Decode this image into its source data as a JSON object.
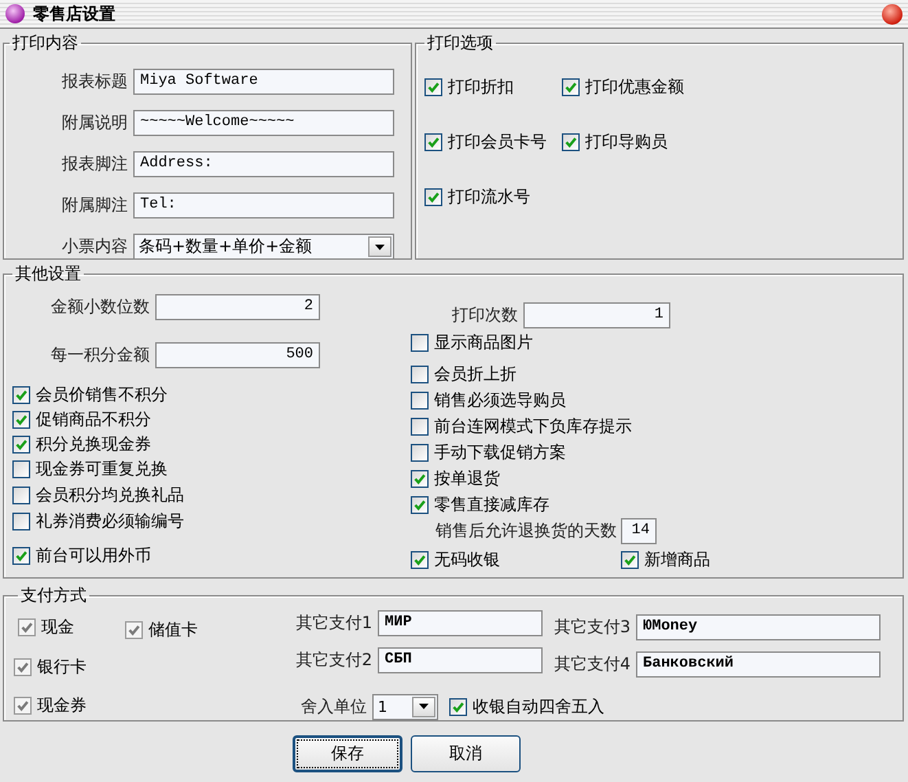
{
  "window": {
    "title": "零售店设置"
  },
  "print_content": {
    "title": "打印内容",
    "fields": [
      {
        "label": "报表标题",
        "value": "Miya Software"
      },
      {
        "label": "附属说明",
        "value": "~~~~~Welcome~~~~~"
      },
      {
        "label": "报表脚注",
        "value": "Address:"
      },
      {
        "label": "附属脚注",
        "value": "Tel:"
      }
    ],
    "receipt": {
      "label": "小票内容",
      "value": "条码+数量+单价+金额"
    }
  },
  "print_options": {
    "title": "打印选项",
    "items": [
      {
        "label": "打印折扣",
        "checked": true
      },
      {
        "label": "打印优惠金额",
        "checked": true
      },
      {
        "label": "打印会员卡号",
        "checked": true
      },
      {
        "label": "打印导购员",
        "checked": true
      },
      {
        "label": "打印流水号",
        "checked": true
      }
    ]
  },
  "other_settings": {
    "title": "其他设置",
    "left_fields": [
      {
        "label": "金额小数位数",
        "value": "2"
      },
      {
        "label": "每一积分金额",
        "value": "500"
      }
    ],
    "left_checks": [
      {
        "label": "会员价销售不积分",
        "checked": true
      },
      {
        "label": "促销商品不积分",
        "checked": true
      },
      {
        "label": "积分兑换现金券",
        "checked": true
      },
      {
        "label": "现金券可重复兑换",
        "checked": false
      },
      {
        "label": "会员积分均兑换礼品",
        "checked": false
      },
      {
        "label": "礼券消费必须输编号",
        "checked": false
      },
      {
        "label": "前台可以用外币",
        "checked": true
      }
    ],
    "print_count": {
      "label": "打印次数",
      "value": "1"
    },
    "right_checks": [
      {
        "label": "显示商品图片",
        "checked": false
      },
      {
        "label": "会员折上折",
        "checked": false
      },
      {
        "label": "销售必须选导购员",
        "checked": false
      },
      {
        "label": "前台连网模式下负库存提示",
        "checked": false
      },
      {
        "label": "手动下载促销方案",
        "checked": false
      },
      {
        "label": "按单退货",
        "checked": true
      },
      {
        "label": "零售直接减库存",
        "checked": true
      }
    ],
    "return_days": {
      "label": "销售后允许退换货的天数",
      "value": "14"
    },
    "bottom_checks": [
      {
        "label": "无码收银",
        "checked": true
      },
      {
        "label": "新增商品",
        "checked": true
      }
    ]
  },
  "payment": {
    "title": "支付方式",
    "methods": [
      {
        "label": "现金",
        "checked": true,
        "disabled": true
      },
      {
        "label": "储值卡",
        "checked": true,
        "disabled": true
      },
      {
        "label": "银行卡",
        "checked": true,
        "disabled": true
      },
      {
        "label": "现金券",
        "checked": true,
        "disabled": true
      }
    ],
    "other": [
      {
        "label": "其它支付1",
        "value": "МИР"
      },
      {
        "label": "其它支付2",
        "value": "СБП"
      },
      {
        "label": "其它支付3",
        "value": "ЮMoney"
      },
      {
        "label": "其它支付4",
        "value": "Банковский"
      }
    ],
    "rounding": {
      "label": "舍入单位",
      "value": "1"
    },
    "auto_round": {
      "label": "收银自动四舍五入",
      "checked": true
    }
  },
  "buttons": [
    {
      "label": "保存",
      "focused": true
    },
    {
      "label": "取消",
      "focused": false
    }
  ]
}
